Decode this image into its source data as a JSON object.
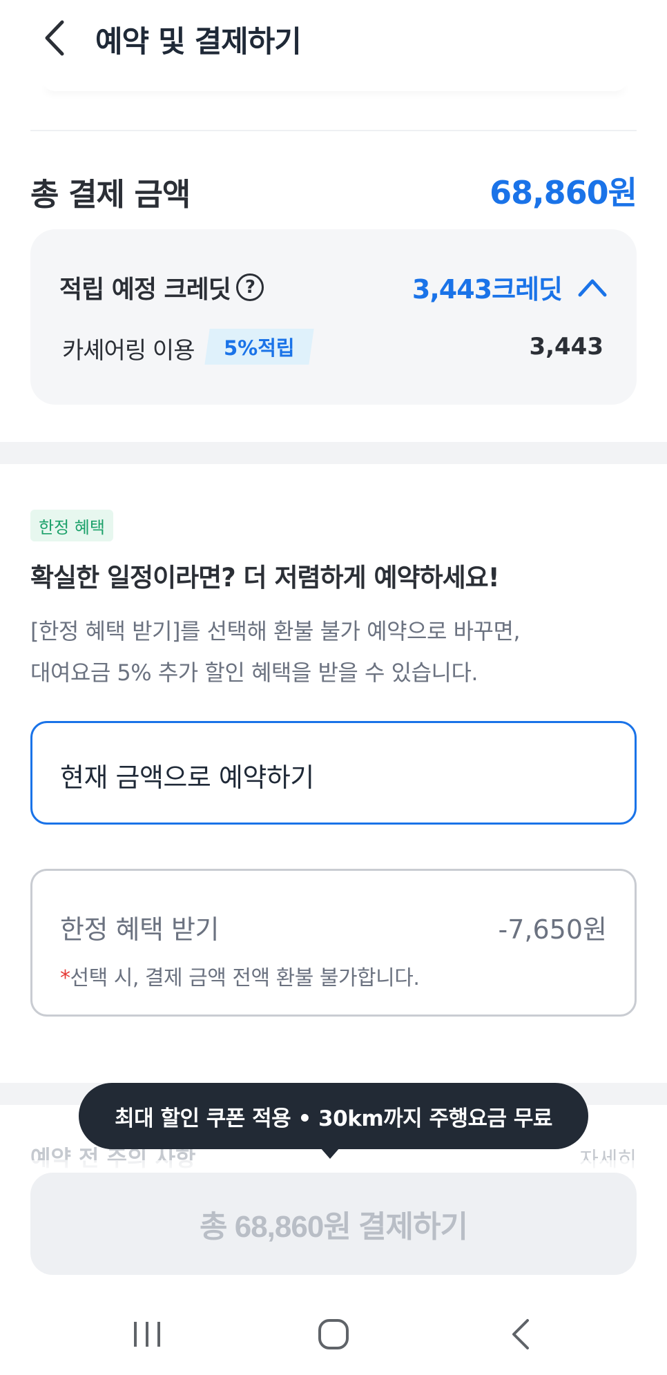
{
  "header": {
    "title": "예약 및 결제하기",
    "back_icon": "chevron-left-icon"
  },
  "total": {
    "label": "총 결제 금액",
    "amount": "68,860원"
  },
  "credit": {
    "title": "적립 예정 크레딧",
    "amount": "3,443크레딧",
    "item_label": "카셰어링 이용",
    "badge": "5%적립",
    "item_value": "3,443",
    "accent_color": "#1a73e8"
  },
  "promo": {
    "tag": "한정 혜택",
    "heading": "확실한 일정이라면? 더 저렴하게 예약하세요!",
    "desc_line1": "[한정 혜택 받기]를 선택해 환불 불가 예약으로 바꾸면,",
    "desc_line2": "대여요금 5% 추가 할인 혜택을 받을 수 있습니다."
  },
  "options": {
    "current": {
      "label": "현재 금액으로 예약하기",
      "selected": true
    },
    "limited": {
      "label": "한정 혜택 받기",
      "amount": "-7,650원",
      "note_mark": "*",
      "note": "선택 시, 결제 금액 전액 환불 불가합니다.",
      "selected": false
    }
  },
  "notice": {
    "title": "예약 전 주의 사항",
    "more": "자세히"
  },
  "tooltip": {
    "text": "최대 할인 쿠폰 적용 • 30km까지 주행요금 무료"
  },
  "pay_button": {
    "label": "총 68,860원 결제하기"
  },
  "system_nav": {
    "recents": "recents-icon",
    "home": "home-icon",
    "back": "back-icon"
  }
}
